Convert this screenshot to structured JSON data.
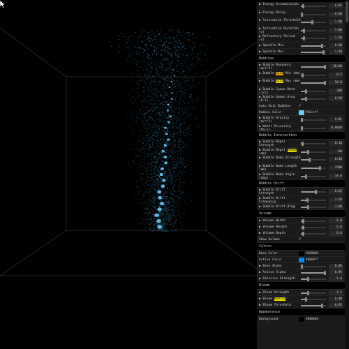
{
  "colors": {
    "bubble": "#66ccff",
    "active": "#0088ff",
    "base": "#000000",
    "background": "#000000"
  },
  "panel": {
    "rows_top": [
      {
        "label": "▶ Energy Accumulation",
        "value": "0.05",
        "pos": 0.1
      },
      {
        "label": "▶ Energy Decay",
        "value": "0.00",
        "pos": 0.05
      },
      {
        "label": "▶ Activation Threshold",
        "value": "1.00",
        "pos": 0.45
      },
      {
        "label": "▶ Activation Duration (s)",
        "value": "1.00",
        "pos": 0.12
      },
      {
        "label": "▶ Refractory Period (s)",
        "value": "1.50",
        "pos": 0.12
      },
      {
        "label": "▶ Sparkle Min",
        "value": "0.90",
        "pos": 0.85
      },
      {
        "label": "▶ Sparkle Max",
        "value": "1.40",
        "pos": 0.9
      }
    ],
    "bubbles_title": "Bubbles",
    "bubbles_rows": [
      {
        "label": "▶ Bubble Buoyancy (m/s^2)",
        "value": "20.00",
        "pos": 0.95
      },
      {
        "label_pre": "▶ Bubble ",
        "label_hl": "Size",
        "label_post": " Min (mm)",
        "hl": "o",
        "value": "0.5",
        "pos": 0.08
      },
      {
        "label_pre": "▶ Bubble ",
        "label_hl": "Size",
        "label_post": " Max (mm)",
        "hl": "y",
        "value": "50.0",
        "pos": 0.95
      },
      {
        "label": "▶ Bubble Spawn Rate (1/s)",
        "value": "200",
        "pos": 0.2
      },
      {
        "label": "▶ Bubble Spawn Area (0-1)",
        "value": "0.20",
        "pos": 0.2
      }
    ],
    "auto_emit_label": "Auto Emit Bubbles",
    "auto_emit_check": "✓",
    "bubble_color_label": "Bubble Color",
    "bubble_color_value": "#66ccff",
    "bubbles_rows2": [
      {
        "label": "▶ Bubble Gravity (m/s^2)",
        "value": "9.81",
        "pos": 0.05
      },
      {
        "label": "▶ Water Viscosity (Pa·s)",
        "value": "0.0010",
        "pos": 0.05
      }
    ],
    "interaction_title": "Bubble Interaction",
    "interaction_rows": [
      {
        "label": "▶ Bubble Repel Strength",
        "value": "0.10",
        "pos": 0.08
      },
      {
        "label_pre": "▶ Bubble Repel ",
        "label_hl": "Range",
        "label_post": " (mm)",
        "hl": "y",
        "value": "80",
        "pos": 0.3
      },
      {
        "label": "▶ Bubble Wake Strength",
        "value": "0.40",
        "pos": 0.35
      },
      {
        "label": "▶ Bubble Wake Length (mm)",
        "value": "1500",
        "pos": 0.75
      },
      {
        "label": "▶ Bubble Wake Angle (deg)",
        "value": "18.0",
        "pos": 0.2
      }
    ],
    "drift_title": "Bubble Drift",
    "drift_rows": [
      {
        "label": "▶ Bubble Drift Strength",
        "value": "0.65",
        "pos": 0.6
      },
      {
        "label": "▶ Bubble Drift Frequency",
        "value": "2.50",
        "pos": 0.25
      },
      {
        "label": "▶ Bubble Drift Drag",
        "value": "3.00",
        "pos": 0.3
      }
    ],
    "volume_title": "Volume",
    "volume_rows": [
      {
        "label": "▶ Volume Width",
        "value": "6.0",
        "pos": 0.1
      },
      {
        "label": "▶ Volume Height",
        "value": "6.0",
        "pos": 0.1
      },
      {
        "label": "▶ Volume Depth",
        "value": "6.0",
        "pos": 0.1
      }
    ],
    "show_volume_label": "Show Volume",
    "show_volume_check": "✓",
    "colors_title": "Colors",
    "base_color_label": "Base Color",
    "base_color_value": "#000000",
    "active_color_label": "Active Color",
    "active_color_value": "#0088ff",
    "colors_rows": [
      {
        "label": "▶ Base Alpha",
        "value": "0.06",
        "pos": 0.05
      },
      {
        "label": "▶ Active Alpha",
        "value": "0.95",
        "pos": 0.95
      },
      {
        "label": "▶ Emissive Strength",
        "value": "1.6",
        "pos": 0.3
      }
    ],
    "bloom_title": "Bloom",
    "bloom_rows": [
      {
        "label": "▶ Bloom Strength",
        "value": "1.1",
        "pos": 0.3
      },
      {
        "label_pre": "▶ Bloom ",
        "label_hl": "Radius",
        "label_post": "",
        "hl": "y",
        "value": "0.40",
        "pos": 0.2
      },
      {
        "label": "▶ Bloom Threshold",
        "value": "0.85",
        "pos": 0.85
      }
    ],
    "appearance_title": "Appearance",
    "background_label": "Background",
    "background_value": "#000000"
  }
}
